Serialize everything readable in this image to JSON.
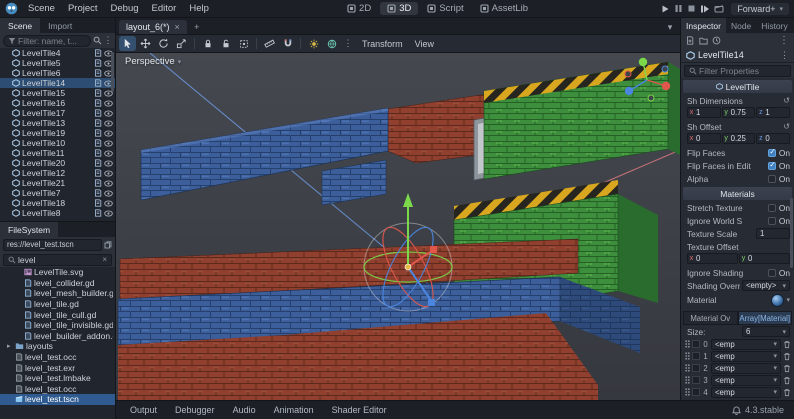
{
  "glyphs": {
    "close": "×",
    "chevron": "▾",
    "plus": "+",
    "menu": "⋮",
    "revert": "↺",
    "folder_arrow": "▸",
    "clear": "×"
  },
  "menubar": {
    "items": [
      "Scene",
      "Project",
      "Debug",
      "Editor",
      "Help"
    ],
    "workspaces": [
      {
        "label": "2D"
      },
      {
        "label": "3D",
        "active": true
      },
      {
        "label": "Script"
      },
      {
        "label": "AssetLib"
      }
    ],
    "renderer": "Forward+"
  },
  "scene_dock": {
    "tabs": [
      {
        "label": "Scene",
        "active": true
      },
      {
        "label": "Import"
      }
    ],
    "filter_placeholder": "Filter: name, t...",
    "nodes": [
      {
        "label": "LevelTile4"
      },
      {
        "label": "LevelTile5"
      },
      {
        "label": "LevelTile6"
      },
      {
        "label": "LevelTile14",
        "selected": true
      },
      {
        "label": "LevelTile15"
      },
      {
        "label": "LevelTile16"
      },
      {
        "label": "LevelTile17"
      },
      {
        "label": "LevelTile13"
      },
      {
        "label": "LevelTile19"
      },
      {
        "label": "LevelTile10"
      },
      {
        "label": "LevelTile11"
      },
      {
        "label": "LevelTile20"
      },
      {
        "label": "LevelTile12"
      },
      {
        "label": "LevelTile21"
      },
      {
        "label": "LevelTile7"
      },
      {
        "label": "LevelTile18"
      },
      {
        "label": "LevelTile8"
      }
    ]
  },
  "filesystem_dock": {
    "title": "FileSystem",
    "path": "res://level_test.tscn",
    "filter_value": "level",
    "files": [
      {
        "label": "LevelTile.svg",
        "icon": "image",
        "indent": "2"
      },
      {
        "label": "level_collider.gd",
        "icon": "script",
        "indent": "2"
      },
      {
        "label": "level_mesh_builder.gd",
        "icon": "script",
        "indent": "2"
      },
      {
        "label": "level_tile.gd",
        "icon": "script",
        "indent": "2"
      },
      {
        "label": "level_tile_cull.gd",
        "icon": "script",
        "indent": "2"
      },
      {
        "label": "level_tile_invisible.gd",
        "icon": "script",
        "indent": "2"
      },
      {
        "label": "level_builder_addon.gd",
        "icon": "script",
        "indent": "2"
      },
      {
        "label": "layouts",
        "icon": "folder",
        "indent": "1"
      },
      {
        "label": "level_test.occ",
        "icon": "file",
        "indent": "1"
      },
      {
        "label": "level_test.exr",
        "icon": "file",
        "indent": "1"
      },
      {
        "label": "level_test.lmbake",
        "icon": "file",
        "indent": "1"
      },
      {
        "label": "level_test.occ",
        "icon": "file",
        "indent": "1"
      },
      {
        "label": "level_test.tscn",
        "icon": "scene",
        "indent": "1",
        "selected": true
      }
    ]
  },
  "main": {
    "scene_tab": "layout_6(*)",
    "menus": [
      "Transform",
      "View"
    ],
    "perspective": "Perspective"
  },
  "inspector": {
    "tabs": [
      {
        "label": "Inspector",
        "active": true
      },
      {
        "label": "Node"
      },
      {
        "label": "History"
      }
    ],
    "selected_node": "LevelTile14",
    "filter_placeholder": "Filter Properties",
    "categories": {
      "level_tile": "LevelTile",
      "materials": "Materials"
    },
    "axes": {
      "x": "x",
      "y": "y",
      "z": "z"
    },
    "props": {
      "sh_dimensions": {
        "label": "Sh Dimensions",
        "x": "1",
        "y": "0.75",
        "z": "1"
      },
      "sh_offset": {
        "label": "Sh Offset",
        "x": "0",
        "y": "0.25",
        "z": "0"
      },
      "flip_faces": {
        "label": "Flip Faces",
        "value": "On",
        "checked": true
      },
      "flip_faces_in_edit": {
        "label": "Flip Faces in Edit",
        "value": "On",
        "checked": true
      },
      "alpha": {
        "label": "Alpha",
        "value": "On",
        "checked": false
      },
      "stretch_texture": {
        "label": "Stretch Texture",
        "value": "On",
        "checked": false
      },
      "ignore_world_scale": {
        "label": "Ignore World S",
        "value": "On",
        "checked": false
      },
      "texture_scale": {
        "label": "Texture Scale",
        "value": "1"
      },
      "texture_offset": {
        "label": "Texture Offset",
        "x": "0",
        "y": "0"
      },
      "ignore_shading": {
        "label": "Ignore Shading",
        "value": "On",
        "checked": false
      },
      "shading_override": {
        "label": "Shading Overri",
        "value": "<empty>"
      },
      "material": {
        "label": "Material"
      }
    },
    "array_editor": {
      "tabs": [
        {
          "label": "Material Ov"
        },
        {
          "label": "Array[Material]",
          "active": true
        }
      ],
      "size_label": "Size:",
      "size": "6",
      "rows": [
        {
          "index": "0",
          "value": "<emp"
        },
        {
          "index": "1",
          "value": "<emp"
        },
        {
          "index": "2",
          "value": "<emp"
        },
        {
          "index": "3",
          "value": "<emp"
        },
        {
          "index": "4",
          "value": "<emp"
        }
      ]
    }
  },
  "bottom_bar": {
    "tabs": [
      "Output",
      "Debugger",
      "Audio",
      "Animation",
      "Shader Editor"
    ],
    "version": "4.3.stable"
  }
}
